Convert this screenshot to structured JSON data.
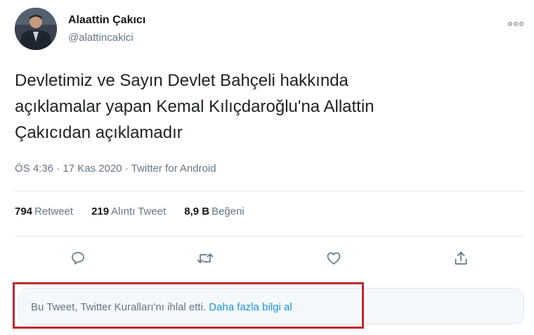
{
  "author": {
    "name": "Alaattin Çakıcı",
    "handle": "@alattincakici"
  },
  "tweet": {
    "text": "Devletimiz ve Sayın Devlet Bahçeli hakkında\naçıklamalar yapan Kemal Kılıçdaroğlu'na Allattin\nÇakıcıdan açıklamadır",
    "time": "ÖS 4:36",
    "separator": "·",
    "date": "17 Kas 2020",
    "source": "Twitter for Android"
  },
  "stats": {
    "retweets_count": "794",
    "retweets_label": "Retweet",
    "quotes_count": "219",
    "quotes_label": "Alıntı Tweet",
    "likes_count": "8,9 B",
    "likes_label": "Beğeni"
  },
  "actions": {
    "icons": [
      "reply-icon",
      "retweet-icon",
      "like-icon",
      "share-icon"
    ]
  },
  "notice": {
    "text": "Bu Tweet, Twitter Kuralları'nı ihlal etti.",
    "link": "Daha fazla bilgi al"
  },
  "colors": {
    "secondary_text": "#657786",
    "link": "#1b95e0",
    "highlight_border": "#c1272d"
  }
}
